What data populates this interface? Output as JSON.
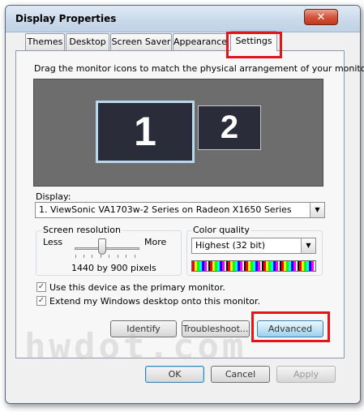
{
  "window": {
    "title": "Display Properties",
    "close_label": "✕"
  },
  "tabs": [
    {
      "label": "Themes"
    },
    {
      "label": "Desktop"
    },
    {
      "label": "Screen Saver"
    },
    {
      "label": "Appearance"
    },
    {
      "label": "Settings",
      "active": true
    }
  ],
  "settings": {
    "instruction": "Drag the monitor icons to match the physical arrangement of your monitors.",
    "monitors": [
      {
        "number": "1",
        "selected": true
      },
      {
        "number": "2",
        "selected": false
      }
    ],
    "display_label": "Display:",
    "display_value": "1. ViewSonic VA1703w-2 Series on Radeon X1650 Series",
    "resolution": {
      "group_label": "Screen resolution",
      "less_label": "Less",
      "more_label": "More",
      "value_text": "1440 by 900 pixels"
    },
    "color_quality": {
      "group_label": "Color quality",
      "value": "Highest (32 bit)"
    },
    "checkboxes": [
      {
        "label": "Use this device as the primary monitor.",
        "checked": true
      },
      {
        "label": "Extend my Windows desktop onto this monitor.",
        "checked": true
      }
    ],
    "buttons": {
      "identify": "Identify",
      "troubleshoot": "Troubleshoot...",
      "advanced": "Advanced"
    }
  },
  "footer": {
    "ok": "OK",
    "cancel": "Cancel",
    "apply": "Apply"
  },
  "watermark": "hwdot.com",
  "colors": {
    "highlight": "#e0161b",
    "monitor": "#2a2c3a",
    "monitor_area": "#6d6d6d"
  }
}
